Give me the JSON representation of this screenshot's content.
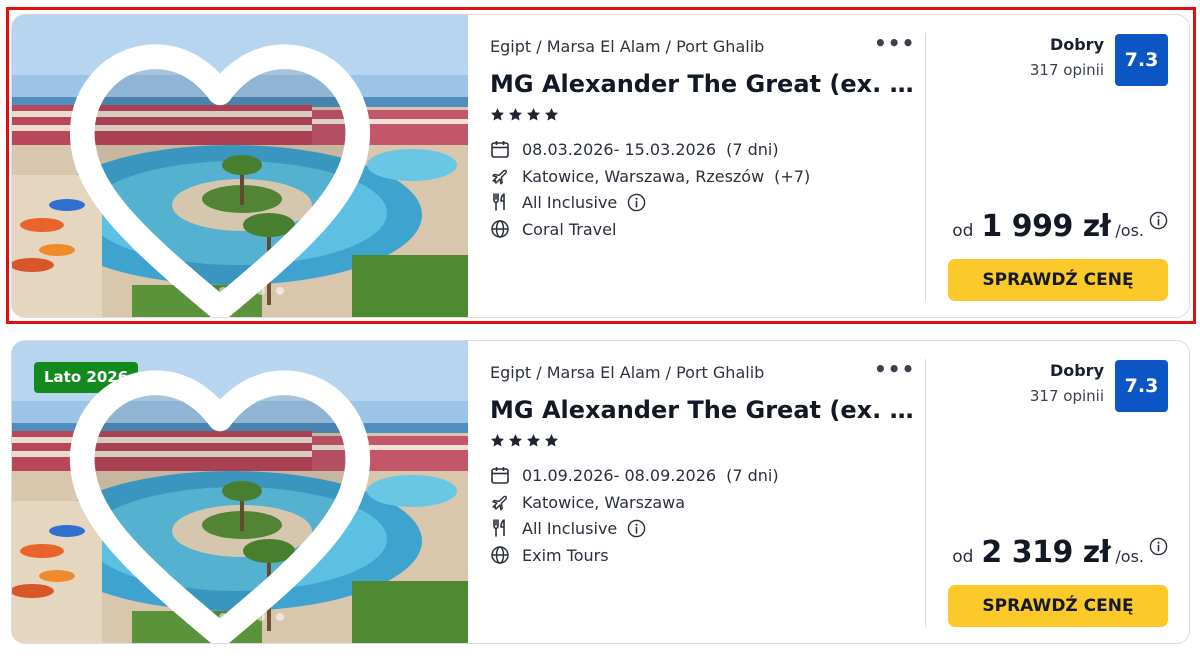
{
  "offers": [
    {
      "badge": "",
      "breadcrumb": "Egipt / Marsa El Alam / Port Ghalib",
      "hotel_name": "MG Alexander The Great (ex. Des…",
      "stars": 4,
      "dates": "08.03.2026- 15.03.2026",
      "duration": "(7 dni)",
      "departures": "Katowice, Warszawa, Rzeszów",
      "departures_more": "(+7)",
      "board": "All Inclusive",
      "operator": "Coral Travel",
      "rating_label": "Dobry",
      "rating_count": "317 opinii",
      "rating_score": "7.3",
      "price_prefix": "od",
      "price": "1 999 zł",
      "price_unit": "/os.",
      "cta": "SPRAWDŹ CENĘ",
      "gallery_active_index": 0,
      "gallery_count": 5
    },
    {
      "badge": "Lato 2026",
      "breadcrumb": "Egipt / Marsa El Alam / Port Ghalib",
      "hotel_name": "MG Alexander The Great (ex. Des…",
      "stars": 4,
      "dates": "01.09.2026- 08.09.2026",
      "duration": "(7 dni)",
      "departures": "Katowice, Warszawa",
      "departures_more": "",
      "board": "All Inclusive",
      "operator": "Exim Tours",
      "rating_label": "Dobry",
      "rating_count": "317 opinii",
      "rating_score": "7.3",
      "price_prefix": "od",
      "price": "2 319 zł",
      "price_unit": "/os.",
      "cta": "SPRAWDŹ CENĘ",
      "gallery_active_index": 0,
      "gallery_count": 5
    }
  ],
  "icons": {
    "favorite": "heart-outline-icon",
    "more": "more-dots-icon",
    "star": "star-icon",
    "calendar": "calendar-icon",
    "departure": "plane-icon",
    "board": "cutlery-icon",
    "operator": "globe-icon",
    "info": "info-circle-icon"
  },
  "colors": {
    "rating_badge": "#0c55c5",
    "cta": "#fcc92b",
    "season_badge": "#138a1e",
    "highlight": "#e01010"
  }
}
